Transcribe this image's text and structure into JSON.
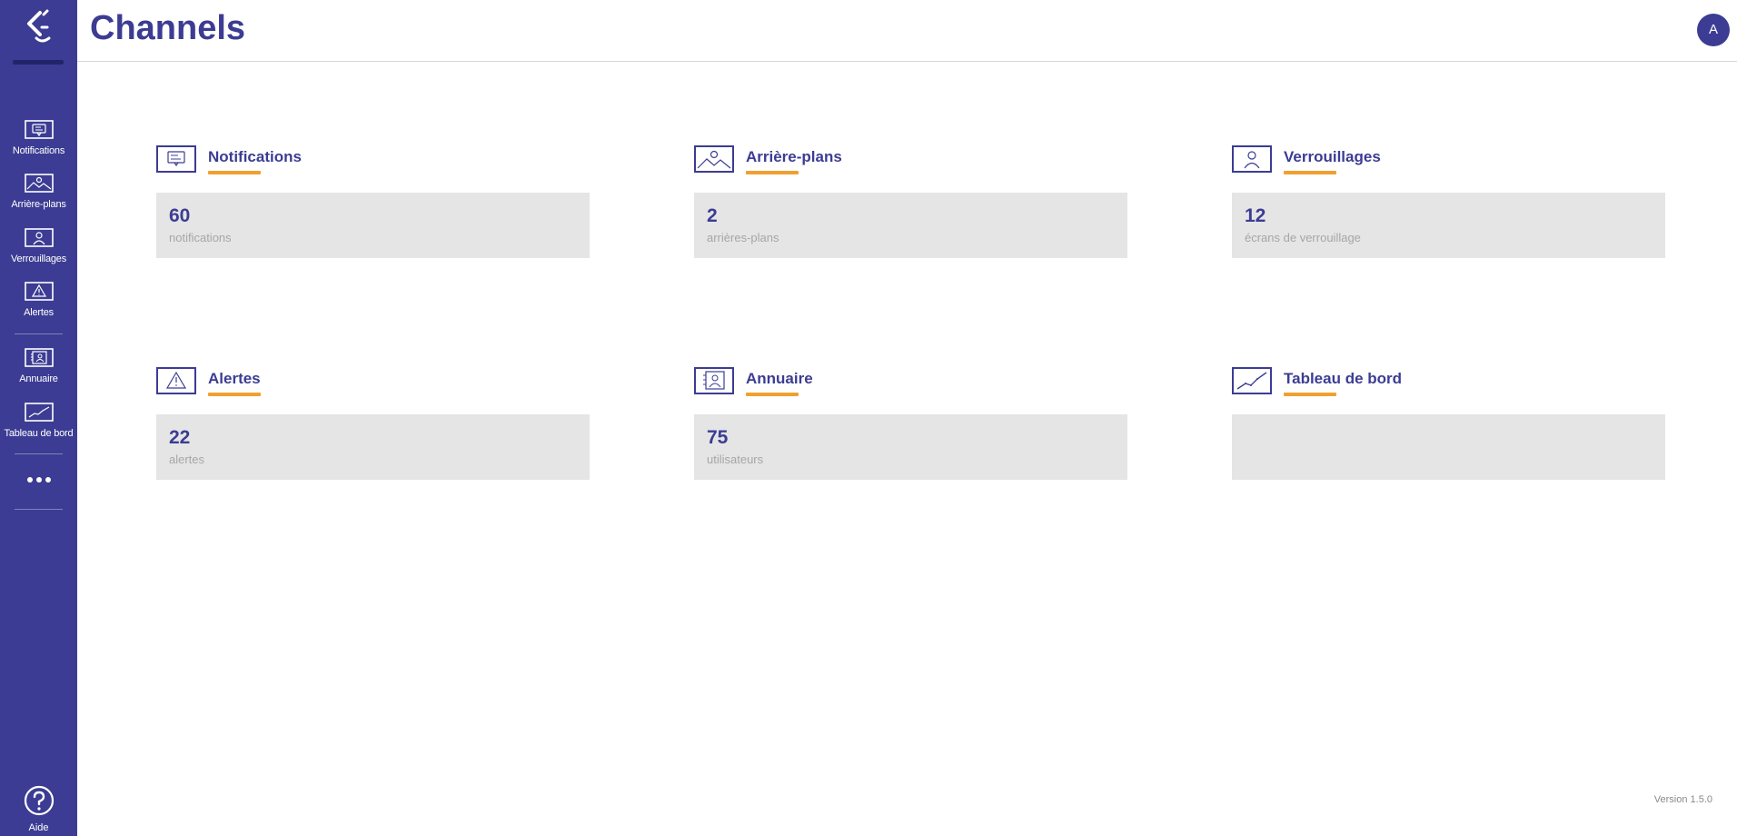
{
  "header": {
    "title": "Channels",
    "avatar_initial": "A"
  },
  "sidebar": {
    "items": [
      {
        "label": "Notifications",
        "icon": "notification-icon"
      },
      {
        "label": "Arrière-plans",
        "icon": "image-icon"
      },
      {
        "label": "Verrouillages",
        "icon": "user-lock-icon"
      },
      {
        "label": "Alertes",
        "icon": "warning-icon"
      },
      {
        "label": "Annuaire",
        "icon": "directory-icon"
      },
      {
        "label": "Tableau de bord",
        "icon": "chart-icon"
      }
    ],
    "more_icon": "more-dots-icon",
    "help_label": "Aide"
  },
  "cards": [
    {
      "title": "Notifications",
      "count": "60",
      "unit": "notifications",
      "icon": "notification-icon"
    },
    {
      "title": "Arrière-plans",
      "count": "2",
      "unit": "arrières-plans",
      "icon": "image-icon"
    },
    {
      "title": "Verrouillages",
      "count": "12",
      "unit": "écrans de verrouillage",
      "icon": "user-lock-icon"
    },
    {
      "title": "Alertes",
      "count": "22",
      "unit": "alertes",
      "icon": "warning-icon"
    },
    {
      "title": "Annuaire",
      "count": "75",
      "unit": "utilisateurs",
      "icon": "directory-icon"
    },
    {
      "title": "Tableau de bord",
      "count": "",
      "unit": "",
      "icon": "chart-icon"
    }
  ],
  "footer": {
    "version": "Version 1.5.0"
  },
  "colors": {
    "primary": "#3c3c94",
    "accent": "#f0a030",
    "card_bg": "#e5e5e5"
  }
}
